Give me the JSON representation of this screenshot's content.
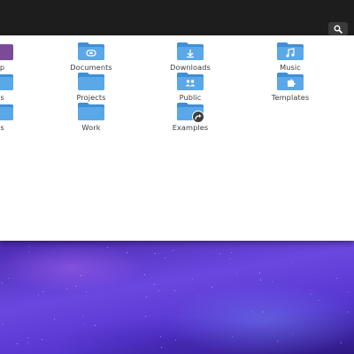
{
  "colors": {
    "folder": "#5aa8e8",
    "folder_dark": "#3f8fd6",
    "folder_symbol": "#ffffff",
    "headerbar": "#1d1d1d",
    "label": "#3c3c3c"
  },
  "headerbar": {
    "search_icon": "search-icon"
  },
  "folders": {
    "row1": {
      "partial": {
        "label": "op",
        "icon": "desktop-folder-icon"
      },
      "documents": {
        "label": "Documents",
        "icon": "documents-folder-icon"
      },
      "downloads": {
        "label": "Downloads",
        "icon": "downloads-folder-icon"
      },
      "music": {
        "label": "Music",
        "icon": "music-folder-icon"
      }
    },
    "row2": {
      "partial": {
        "label": "es",
        "icon": "pictures-folder-icon"
      },
      "projects": {
        "label": "Projects",
        "icon": "folder-icon"
      },
      "public": {
        "label": "Public",
        "icon": "public-folder-icon"
      },
      "templates": {
        "label": "Templates",
        "icon": "templates-folder-icon"
      }
    },
    "row3": {
      "partial": {
        "label": "os",
        "icon": "videos-folder-icon"
      },
      "work": {
        "label": "Work",
        "icon": "folder-icon"
      },
      "examples": {
        "label": "Examples",
        "icon": "symlink-folder-icon"
      }
    }
  }
}
